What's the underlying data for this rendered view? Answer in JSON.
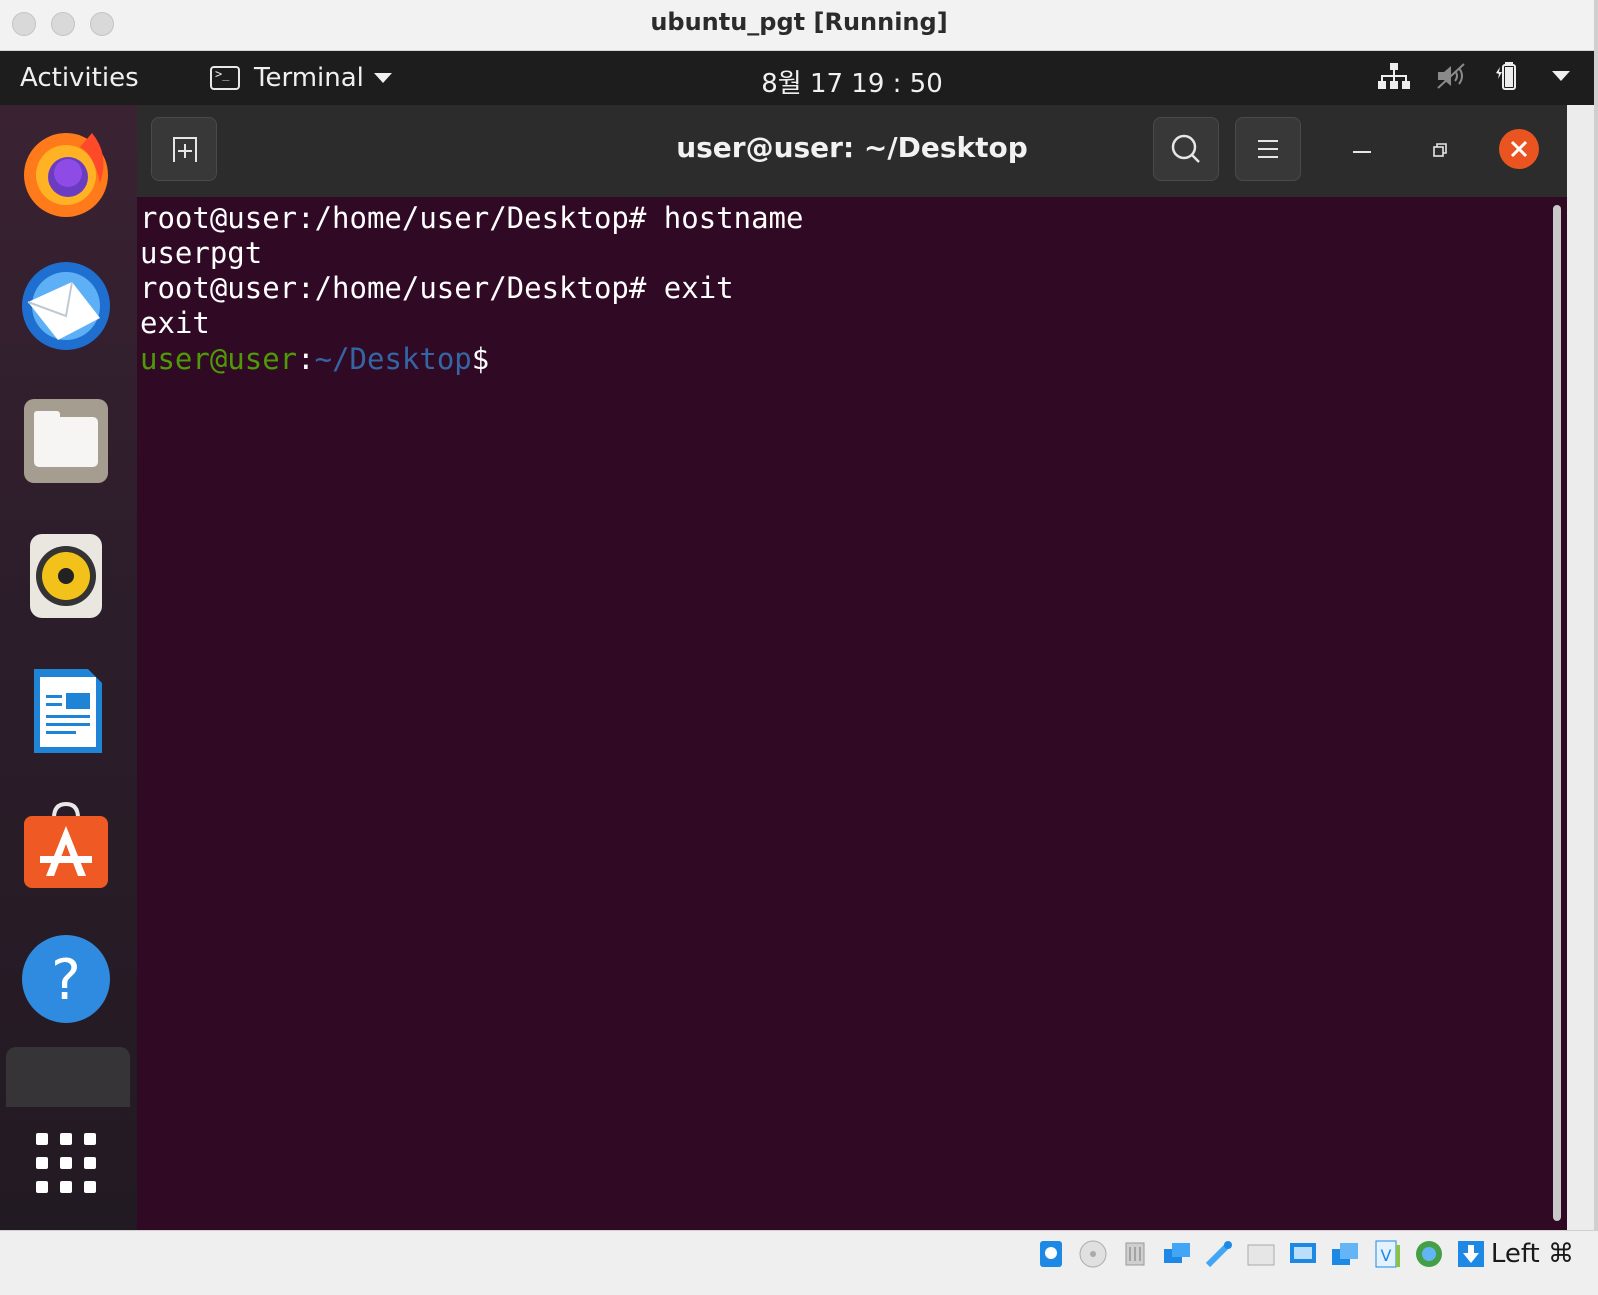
{
  "window": {
    "title": "ubuntu_pgt [Running]"
  },
  "topbar": {
    "activities": "Activities",
    "app_menu": "Terminal",
    "clock": "8월 17  19 : 50"
  },
  "dock": {
    "items": [
      "firefox-icon",
      "thunderbird-icon",
      "files-icon",
      "rhythmbox-icon",
      "writer-icon",
      "software-icon",
      "help-icon",
      "terminal-icon",
      "show-apps-icon"
    ]
  },
  "terminal": {
    "title": "user@user: ~/Desktop",
    "lines": [
      {
        "text": "root@user:/home/user/Desktop# hostname"
      },
      {
        "text": "userpgt"
      },
      {
        "text": "root@user:/home/user/Desktop# exit"
      },
      {
        "text": "exit"
      }
    ],
    "prompt": {
      "user": "user@user",
      "sep": ":",
      "path": "~/Desktop",
      "symbol": "$"
    }
  },
  "statusbar": {
    "host_key": "Left ⌘"
  },
  "colors": {
    "terminal_bg": "#300a24",
    "prompt_user": "#4e9a06",
    "prompt_path": "#3465a4",
    "close_button": "#e95420"
  }
}
